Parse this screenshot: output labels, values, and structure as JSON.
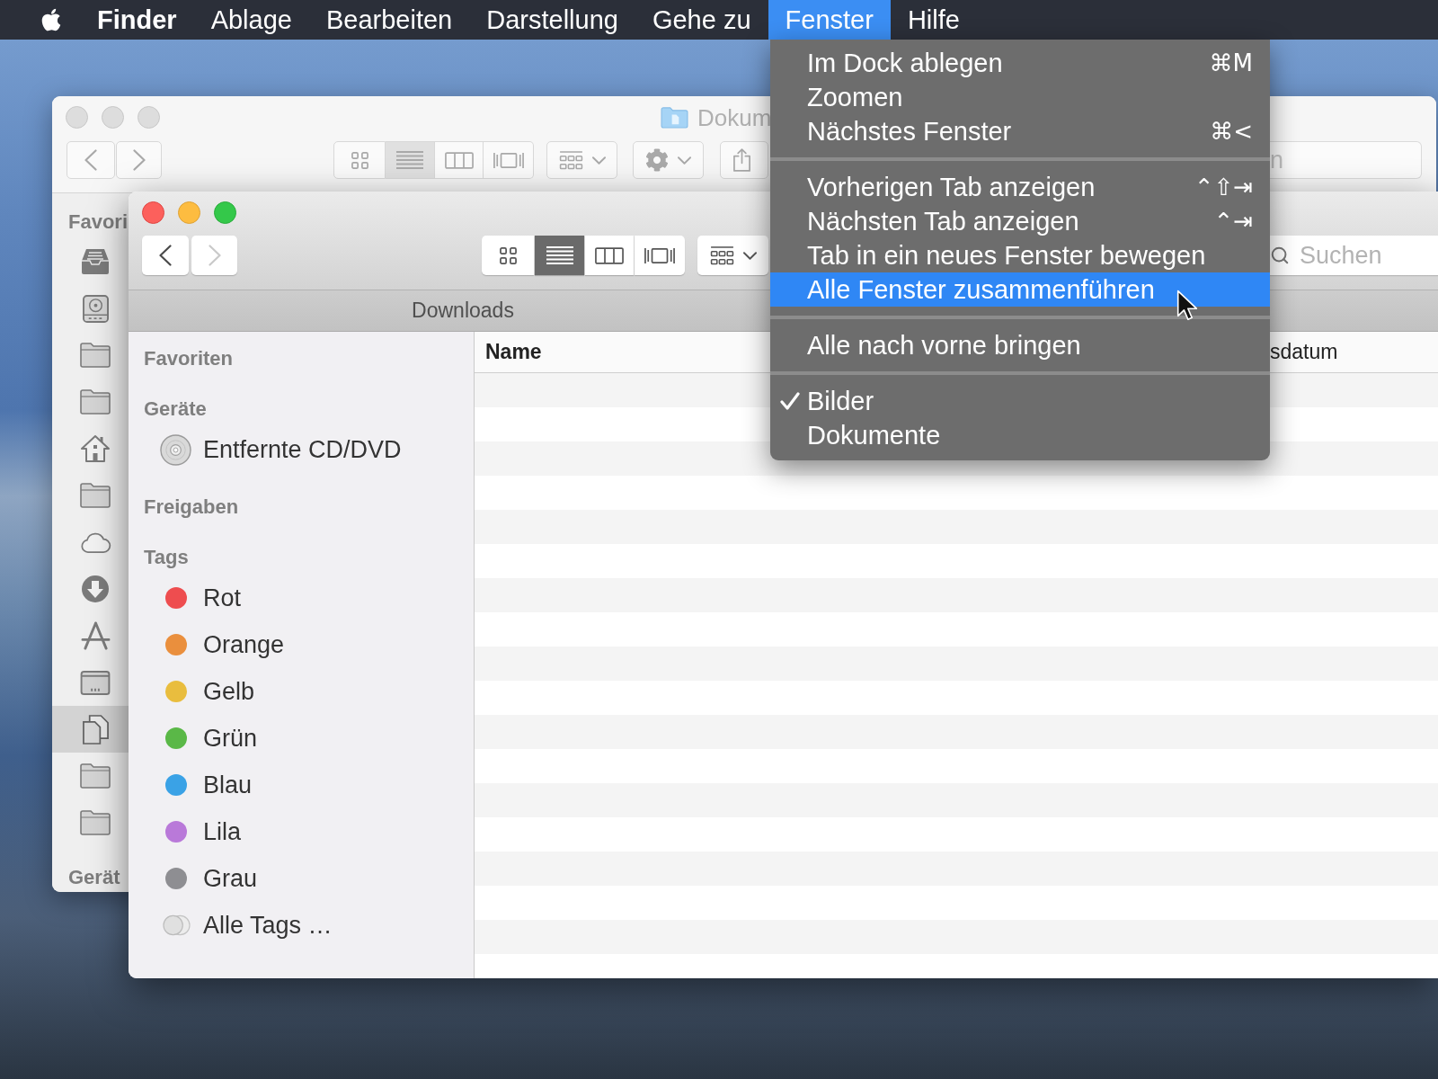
{
  "menu_bar": {
    "items": [
      {
        "label": "Finder",
        "kind": "app",
        "selected": false
      },
      {
        "label": "Ablage",
        "kind": "menu",
        "selected": false
      },
      {
        "label": "Bearbeiten",
        "kind": "menu",
        "selected": false
      },
      {
        "label": "Darstellung",
        "kind": "menu",
        "selected": false
      },
      {
        "label": "Gehe zu",
        "kind": "menu",
        "selected": false
      },
      {
        "label": "Fenster",
        "kind": "menu",
        "selected": true
      },
      {
        "label": "Hilfe",
        "kind": "menu",
        "selected": false
      }
    ]
  },
  "back_window": {
    "active": false,
    "title": "Dokum",
    "view_modes": [
      {
        "kind": "icons",
        "selected": false
      },
      {
        "kind": "list",
        "selected": true
      },
      {
        "kind": "columns",
        "selected": false
      },
      {
        "kind": "coverflow",
        "selected": false
      }
    ],
    "search": {
      "placeholder": "n"
    },
    "sidebar": {
      "heading": "Favori",
      "items": [
        {
          "kind": "tray",
          "selected": false
        },
        {
          "kind": "drive",
          "selected": false
        },
        {
          "kind": "folder",
          "selected": false
        },
        {
          "kind": "folder",
          "selected": false
        },
        {
          "kind": "home",
          "selected": false
        },
        {
          "kind": "folder",
          "selected": false
        },
        {
          "kind": "cloud",
          "selected": false
        },
        {
          "kind": "download",
          "selected": false
        },
        {
          "kind": "tools",
          "selected": false
        },
        {
          "kind": "screen",
          "selected": false
        },
        {
          "kind": "documents",
          "selected": true
        },
        {
          "kind": "folder",
          "selected": false
        },
        {
          "kind": "folder",
          "selected": false
        }
      ],
      "footer_heading": "Gerät"
    }
  },
  "front_window": {
    "active": true,
    "navigation": [
      {
        "kind": "back",
        "disabled": false
      },
      {
        "kind": "forward",
        "disabled": true
      }
    ],
    "view_modes": [
      {
        "kind": "icons",
        "selected": false
      },
      {
        "kind": "list",
        "selected": true
      },
      {
        "kind": "columns",
        "selected": false
      },
      {
        "kind": "coverflow",
        "selected": false
      }
    ],
    "search": {
      "placeholder": "Suchen"
    },
    "tab": {
      "label": "Downloads"
    },
    "sidebar": {
      "sections": [
        {
          "heading": "Favoriten"
        },
        {
          "heading": "Geräte",
          "items": [
            {
              "kind": "disc",
              "label": "Entfernte CD/DVD"
            }
          ]
        },
        {
          "heading": "Freigaben"
        },
        {
          "heading": "Tags",
          "items": [
            {
              "kind": "tag",
              "label": "Rot",
              "color": "#ee4d4f"
            },
            {
              "kind": "tag",
              "label": "Orange",
              "color": "#ea8f3d"
            },
            {
              "kind": "tag",
              "label": "Gelb",
              "color": "#e9bd3e"
            },
            {
              "kind": "tag",
              "label": "Grün",
              "color": "#5ab847"
            },
            {
              "kind": "tag",
              "label": "Blau",
              "color": "#3aa2e6"
            },
            {
              "kind": "tag",
              "label": "Lila",
              "color": "#b979d9"
            },
            {
              "kind": "tag",
              "label": "Grau",
              "color": "#8e8e92"
            },
            {
              "kind": "all",
              "label": "Alle Tags …"
            }
          ]
        }
      ]
    },
    "table": {
      "columns": [
        {
          "label": "Name",
          "sorted": true
        },
        {
          "label": "sdatum",
          "sorted": false
        }
      ]
    }
  },
  "window_menu": {
    "groups": [
      {
        "items": [
          {
            "label": "Im Dock ablegen",
            "shortcut": "⌘M",
            "selected": false,
            "checked": false
          },
          {
            "label": "Zoomen",
            "selected": false,
            "checked": false
          },
          {
            "label": "Nächstes Fenster",
            "shortcut": "⌘<",
            "selected": false,
            "checked": false
          }
        ]
      },
      {
        "items": [
          {
            "label": "Vorherigen Tab anzeigen",
            "shortcut": "⌃⇧⇥",
            "selected": false,
            "checked": false
          },
          {
            "label": "Nächsten Tab anzeigen",
            "shortcut": "⌃⇥",
            "selected": false,
            "checked": false
          },
          {
            "label": "Tab in ein neues Fenster bewegen",
            "selected": false,
            "checked": false
          },
          {
            "label": "Alle Fenster zusammenführen",
            "selected": true,
            "checked": false
          }
        ]
      },
      {
        "items": [
          {
            "label": "Alle nach vorne bringen",
            "selected": false,
            "checked": false
          }
        ]
      },
      {
        "items": [
          {
            "label": "Bilder",
            "selected": false,
            "checked": true
          },
          {
            "label": "Dokumente",
            "selected": false,
            "checked": false
          }
        ]
      }
    ]
  }
}
